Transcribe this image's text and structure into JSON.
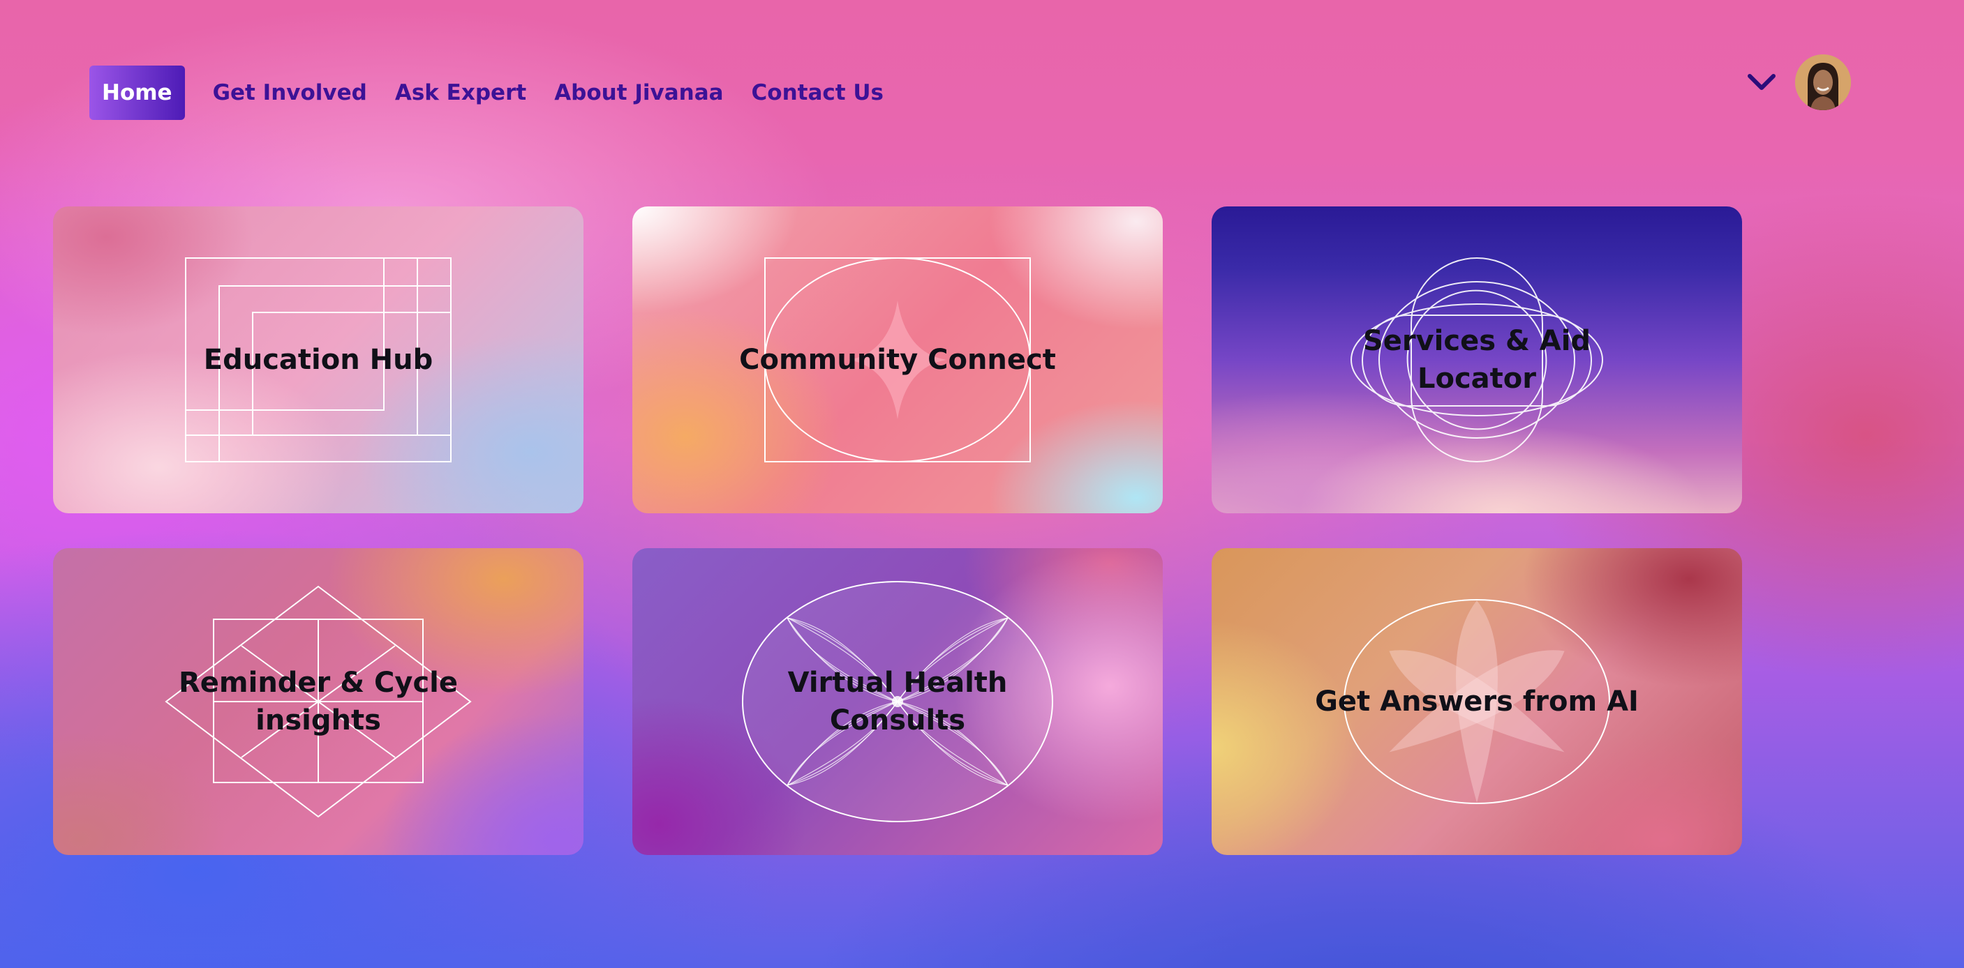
{
  "nav": {
    "items": [
      {
        "label": "Home",
        "active": true
      },
      {
        "label": "Get Involved"
      },
      {
        "label": "Ask Expert"
      },
      {
        "label": "About Jivanaa"
      },
      {
        "label": "Contact Us"
      }
    ],
    "menu_icon": "chevron-down-icon",
    "avatar_icon": "user-avatar"
  },
  "cards": [
    {
      "title": "Education Hub",
      "icon": "nested-rectangles-pattern"
    },
    {
      "title": "Community Connect",
      "icon": "four-point-star-in-circle"
    },
    {
      "title": "Services & Aid Locator",
      "icon": "overlapping-rounded-shapes"
    },
    {
      "title": "Reminder & Cycle insights",
      "icon": "diamond-grid-pattern"
    },
    {
      "title": "Virtual Health Consults",
      "icon": "petal-lines-in-circle"
    },
    {
      "title": "Get Answers from AI",
      "icon": "lotus-flower-in-circle"
    }
  ],
  "colors": {
    "nav_text": "#3c1296",
    "home_button_start": "#9b55e8",
    "home_button_end": "#4d1bb6",
    "card_title": "#101018"
  }
}
